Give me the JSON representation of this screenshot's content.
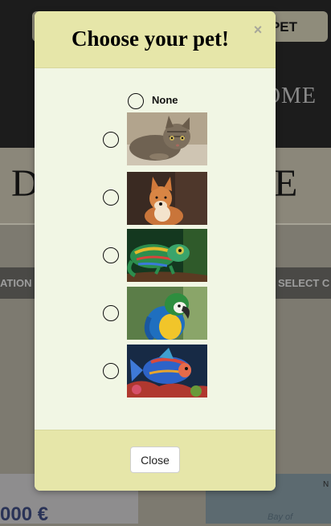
{
  "background": {
    "pet_button_label": "PET",
    "nav_home": "OME",
    "hero_left": "D",
    "hero_right": "E",
    "band_left": "ATION",
    "band_right": "SELECT C",
    "price": "000 €",
    "map_label": "Bay of",
    "map_letter": "N"
  },
  "modal": {
    "title": "Choose your pet!",
    "close_symbol": "×",
    "none_label": "None",
    "options": [
      {
        "name": "cat",
        "icon": "cat-image"
      },
      {
        "name": "dog",
        "icon": "dog-image"
      },
      {
        "name": "chameleon",
        "icon": "chameleon-image"
      },
      {
        "name": "parrot",
        "icon": "parrot-image"
      },
      {
        "name": "fish",
        "icon": "fish-image"
      }
    ],
    "close_button_label": "Close"
  }
}
